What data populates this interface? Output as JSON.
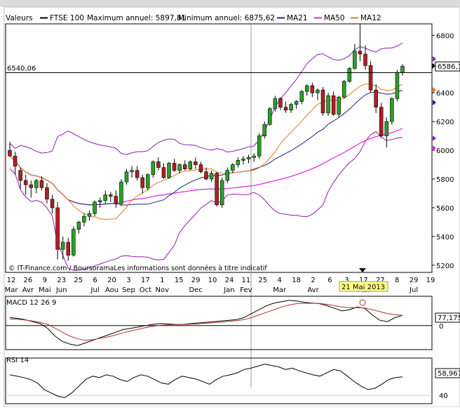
{
  "header": {
    "title": "Valeurs",
    "instrument": "FTSE 100",
    "max_text": "Maximum annuel: 5897,81",
    "min_text": "Minimum annuel: 6875,62",
    "ma21": "MA21",
    "ma50": "MA50",
    "ma12": "MA12"
  },
  "colors": {
    "candle_up": "#2ca02c",
    "candle_down": "#b02020",
    "bollinger": "#8e1bb0",
    "ma21": "#1a237e",
    "ma50": "#e020e0",
    "ma12": "#e07a1a",
    "macd": "#000000",
    "signal": "#b03030",
    "rsi": "#000000"
  },
  "chart_data": [
    {
      "type": "candlestick",
      "title": "FTSE 100",
      "ylim": [
        5150,
        6880
      ],
      "y_ticks": [
        5200,
        5400,
        5600,
        5800,
        6000,
        6200,
        6400,
        6600,
        6800
      ],
      "hline": {
        "value": 6540.06,
        "label": "6540,06"
      },
      "last_value_label": "6586,1",
      "x_labels": [
        {
          "day": "12",
          "month": "Mar"
        },
        {
          "day": "26",
          "month": "Avr"
        },
        {
          "day": "9",
          "month": "Mai"
        },
        {
          "day": "23",
          "month": "Jun"
        },
        {
          "day": "25",
          "month": ""
        },
        {
          "day": "6",
          "month": "Jul"
        },
        {
          "day": "20",
          "month": "Aou"
        },
        {
          "day": "3",
          "month": "Sep"
        },
        {
          "day": "17",
          "month": "Oct"
        },
        {
          "day": "1",
          "month": "Nov"
        },
        {
          "day": "15",
          "month": ""
        },
        {
          "day": "29",
          "month": "Dec"
        },
        {
          "day": "10",
          "month": ""
        },
        {
          "day": "24",
          "month": "Jan"
        },
        {
          "day": "11",
          "month": "Fev"
        },
        {
          "day": "25",
          "month": ""
        },
        {
          "day": "4",
          "month": "Mar"
        },
        {
          "day": "18",
          "month": ""
        },
        {
          "day": "2",
          "month": "Avr"
        },
        {
          "day": "6",
          "month": ""
        },
        {
          "day": "3",
          "month": ""
        },
        {
          "day": "17",
          "month": "Mai"
        },
        {
          "day": "27",
          "month": ""
        },
        {
          "day": "8",
          "month": ""
        },
        {
          "day": "29",
          "month": "Jul"
        },
        {
          "day": "19",
          "month": ""
        }
      ],
      "cursor_label": "21 Mai 2013",
      "candles": [
        [
          6000,
          6060,
          5960,
          5960
        ],
        [
          5960,
          5990,
          5830,
          5890
        ],
        [
          5860,
          5880,
          5730,
          5790
        ],
        [
          5790,
          5830,
          5690,
          5760
        ],
        [
          5760,
          5790,
          5670,
          5740
        ],
        [
          5740,
          5800,
          5700,
          5790
        ],
        [
          5790,
          5820,
          5720,
          5740
        ],
        [
          5740,
          5770,
          5630,
          5660
        ],
        [
          5660,
          5690,
          5560,
          5600
        ],
        [
          5600,
          5640,
          5240,
          5310
        ],
        [
          5310,
          5400,
          5240,
          5360
        ],
        [
          5360,
          5390,
          5230,
          5270
        ],
        [
          5270,
          5470,
          5260,
          5450
        ],
        [
          5450,
          5510,
          5420,
          5500
        ],
        [
          5500,
          5560,
          5470,
          5540
        ],
        [
          5540,
          5580,
          5510,
          5560
        ],
        [
          5560,
          5650,
          5540,
          5640
        ],
        [
          5640,
          5670,
          5600,
          5650
        ],
        [
          5650,
          5720,
          5630,
          5690
        ],
        [
          5690,
          5710,
          5640,
          5680
        ],
        [
          5680,
          5720,
          5600,
          5630
        ],
        [
          5630,
          5800,
          5610,
          5780
        ],
        [
          5780,
          5870,
          5760,
          5850
        ],
        [
          5850,
          5890,
          5810,
          5860
        ],
        [
          5860,
          5890,
          5790,
          5810
        ],
        [
          5810,
          5830,
          5700,
          5740
        ],
        [
          5740,
          5840,
          5720,
          5830
        ],
        [
          5830,
          5930,
          5810,
          5920
        ],
        [
          5920,
          5950,
          5860,
          5880
        ],
        [
          5880,
          5910,
          5800,
          5810
        ],
        [
          5810,
          5920,
          5800,
          5910
        ],
        [
          5910,
          5940,
          5850,
          5860
        ],
        [
          5860,
          5910,
          5840,
          5900
        ],
        [
          5900,
          5930,
          5860,
          5870
        ],
        [
          5870,
          5930,
          5860,
          5920
        ],
        [
          5920,
          5950,
          5870,
          5900
        ],
        [
          5900,
          5920,
          5840,
          5850
        ],
        [
          5850,
          5880,
          5790,
          5800
        ],
        [
          5800,
          5860,
          5780,
          5840
        ],
        [
          5840,
          5850,
          5610,
          5620
        ],
        [
          5620,
          5810,
          5600,
          5790
        ],
        [
          5790,
          5880,
          5770,
          5860
        ],
        [
          5860,
          5910,
          5840,
          5900
        ],
        [
          5900,
          5950,
          5880,
          5930
        ],
        [
          5930,
          5960,
          5900,
          5940
        ],
        [
          5940,
          5970,
          5910,
          5950
        ],
        [
          5950,
          5980,
          5920,
          5960
        ],
        [
          5960,
          6120,
          5940,
          6100
        ],
        [
          6100,
          6200,
          6080,
          6180
        ],
        [
          6180,
          6300,
          6170,
          6290
        ],
        [
          6290,
          6380,
          6270,
          6360
        ],
        [
          6360,
          6370,
          6280,
          6300
        ],
        [
          6300,
          6340,
          6260,
          6280
        ],
        [
          6280,
          6330,
          6260,
          6320
        ],
        [
          6320,
          6350,
          6290,
          6340
        ],
        [
          6340,
          6420,
          6320,
          6410
        ],
        [
          6410,
          6460,
          6380,
          6450
        ],
        [
          6450,
          6470,
          6370,
          6400
        ],
        [
          6400,
          6430,
          6350,
          6420
        ],
        [
          6420,
          6440,
          6240,
          6260
        ],
        [
          6260,
          6400,
          6240,
          6380
        ],
        [
          6380,
          6410,
          6240,
          6250
        ],
        [
          6250,
          6380,
          6230,
          6370
        ],
        [
          6370,
          6490,
          6360,
          6480
        ],
        [
          6480,
          6580,
          6470,
          6570
        ],
        [
          6570,
          6740,
          6560,
          6690
        ],
        [
          6690,
          6880,
          6620,
          6670
        ],
        [
          6670,
          6730,
          6560,
          6590
        ],
        [
          6590,
          6620,
          6400,
          6420
        ],
        [
          6420,
          6460,
          6260,
          6300
        ],
        [
          6300,
          6330,
          6090,
          6100
        ],
        [
          6100,
          6230,
          6020,
          6200
        ],
        [
          6200,
          6370,
          6180,
          6360
        ],
        [
          6360,
          6560,
          6340,
          6540
        ],
        [
          6540,
          6600,
          6520,
          6586.1
        ]
      ],
      "ma21_label": "MA21",
      "ma50_label": "MA50",
      "ma12_label": "MA12"
    },
    {
      "type": "line",
      "title": "MACD 12 26 9",
      "last_value_label": "77,175",
      "y_tick": "0",
      "series": [
        {
          "name": "MACD",
          "values": [
            60,
            55,
            45,
            30,
            15,
            -20,
            -80,
            -120,
            -140,
            -150,
            -130,
            -110,
            -90,
            -70,
            -50,
            -30,
            -20,
            -10,
            0,
            10,
            15,
            12,
            8,
            10,
            15,
            20,
            25,
            30,
            35,
            40,
            45,
            60,
            90,
            120,
            150,
            170,
            180,
            190,
            185,
            175,
            170,
            165,
            150,
            130,
            110,
            120,
            140,
            130,
            80,
            40,
            30,
            60,
            77
          ]
        },
        {
          "name": "Signal",
          "values": [
            50,
            48,
            42,
            35,
            25,
            10,
            -20,
            -50,
            -80,
            -100,
            -110,
            -105,
            -95,
            -85,
            -70,
            -55,
            -40,
            -28,
            -15,
            -5,
            3,
            6,
            8,
            9,
            11,
            14,
            18,
            22,
            27,
            32,
            37,
            45,
            60,
            80,
            100,
            120,
            140,
            155,
            165,
            168,
            168,
            166,
            160,
            150,
            140,
            135,
            135,
            132,
            120,
            105,
            90,
            82,
            77
          ]
        }
      ]
    },
    {
      "type": "line",
      "title": "RSI 14",
      "last_value_label": "58,967",
      "y_tick": "40",
      "series": [
        {
          "name": "RSI",
          "values": [
            62,
            60,
            58,
            55,
            50,
            40,
            35,
            30,
            28,
            35,
            45,
            55,
            60,
            58,
            62,
            60,
            55,
            52,
            58,
            62,
            60,
            55,
            50,
            48,
            55,
            60,
            58,
            56,
            52,
            48,
            55,
            60,
            62,
            65,
            70,
            72,
            75,
            78,
            76,
            74,
            70,
            72,
            68,
            65,
            62,
            60,
            65,
            70,
            68,
            60,
            52,
            45,
            40,
            42,
            48,
            55,
            58,
            59
          ]
        }
      ]
    }
  ]
}
